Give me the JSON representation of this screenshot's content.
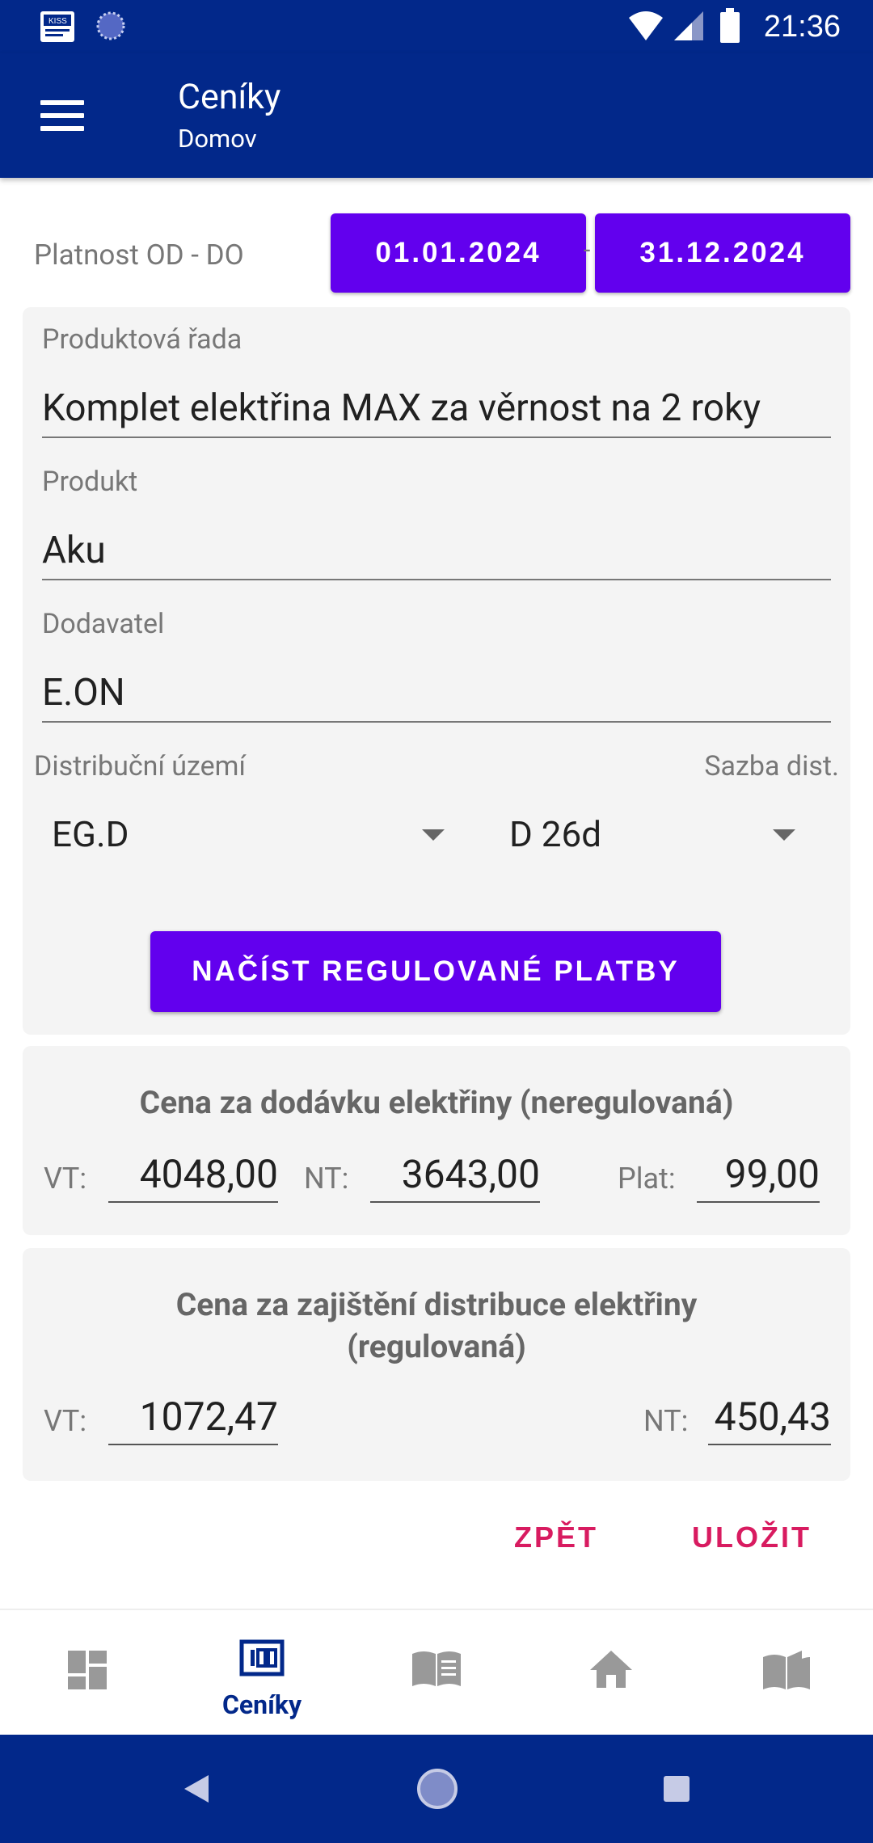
{
  "status_bar": {
    "time": "21:36",
    "icons": [
      "kiss-app-icon",
      "sync-icon",
      "wifi-icon",
      "signal-icon",
      "battery-icon"
    ]
  },
  "app_bar": {
    "title": "Ceníky",
    "subtitle": "Domov",
    "menu_icon": "hamburger-menu-icon"
  },
  "validity": {
    "label": "Platnost OD - DO",
    "from": "01.01.2024",
    "to": "31.12.2024",
    "separator": "-"
  },
  "form": {
    "product_line_label": "Produktová řada",
    "product_line_value": "Komplet elektřina MAX za věrnost na 2 roky",
    "product_label": "Produkt",
    "product_value": "Aku",
    "supplier_label": "Dodavatel",
    "supplier_value": "E.ON",
    "distribution_area_label": "Distribuční území",
    "distribution_area_value": "EG.D",
    "rate_label": "Sazba dist.",
    "rate_value": "D 26d",
    "load_button": "NAČÍST REGULOVANÉ PLATBY"
  },
  "supply_price": {
    "title": "Cena za dodávku elektřiny (neregulovaná)",
    "vt_label": "VT:",
    "vt_value": "4048,00",
    "nt_label": "NT:",
    "nt_value": "3643,00",
    "plat_label": "Plat:",
    "plat_value": "99,00"
  },
  "distribution_price": {
    "title_line1": "Cena za zajištění distribuce elektřiny",
    "title_line2": "(regulovaná)",
    "vt_label": "VT:",
    "vt_value": "1072,47",
    "nt_label": "NT:",
    "nt_value": "450,43"
  },
  "actions": {
    "back": "ZPĚT",
    "save": "ULOŽIT"
  },
  "bottom_nav": {
    "items": [
      {
        "icon": "dashboard-icon",
        "label": ""
      },
      {
        "icon": "price-list-icon",
        "label": "Ceníky",
        "active": true
      },
      {
        "icon": "book-icon",
        "label": ""
      },
      {
        "icon": "home-icon",
        "label": ""
      },
      {
        "icon": "map-book-icon",
        "label": ""
      }
    ]
  },
  "colors": {
    "primary_dark": "#02288a",
    "accent_purple": "#6200ee",
    "action_pink": "#d81b60",
    "card_bg": "#f4f4f4"
  }
}
